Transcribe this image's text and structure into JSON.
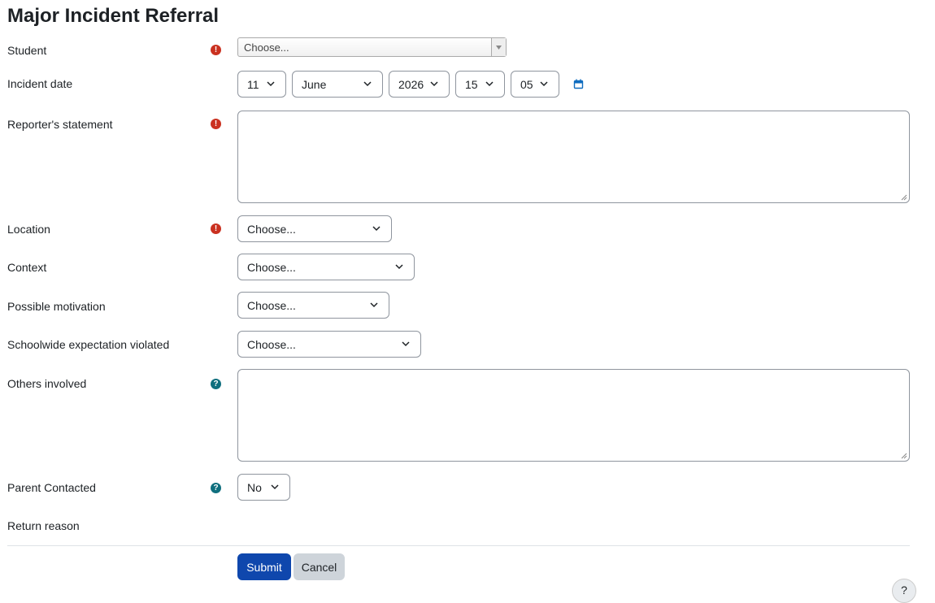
{
  "form": {
    "title": "Major Incident Referral",
    "student": {
      "label": "Student",
      "placeholder": "Choose..."
    },
    "incident_date": {
      "label": "Incident date",
      "day": "11",
      "month": "June",
      "year": "2026",
      "hour": "15",
      "minute": "05"
    },
    "reporter_statement": {
      "label": "Reporter's statement",
      "value": ""
    },
    "location": {
      "label": "Location",
      "value": "Choose..."
    },
    "context": {
      "label": "Context",
      "value": "Choose..."
    },
    "motivation": {
      "label": "Possible motivation",
      "value": "Choose..."
    },
    "expectation": {
      "label": "Schoolwide expectation violated",
      "value": "Choose..."
    },
    "others_involved": {
      "label": "Others involved",
      "value": ""
    },
    "parent_contacted": {
      "label": "Parent Contacted",
      "value": "No"
    },
    "return_reason": {
      "label": "Return reason"
    }
  },
  "buttons": {
    "submit": "Submit",
    "cancel": "Cancel"
  },
  "icons": {
    "required": "exclamation-circle-icon",
    "help": "question-circle-icon",
    "calendar": "calendar-icon",
    "chevron": "chevron-down-icon"
  },
  "colors": {
    "required": "#ca3120",
    "help": "#0f6f7e",
    "primary_button": "#0f47ad",
    "secondary_button": "#ced4da",
    "calendar_icon": "#0f6cbf"
  }
}
